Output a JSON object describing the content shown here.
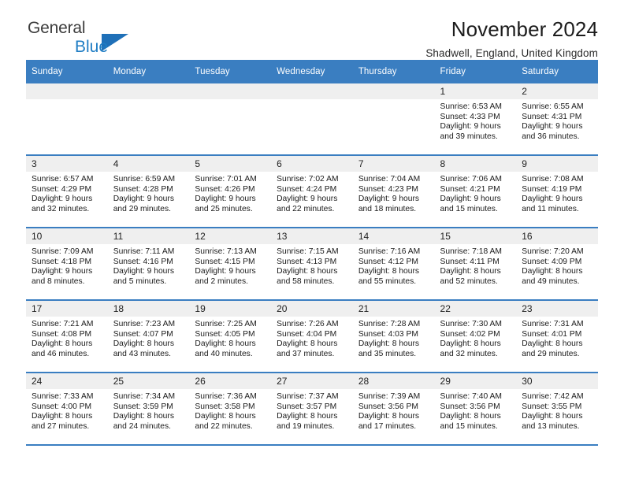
{
  "brand": {
    "name_part1": "General",
    "name_part2": "Blue",
    "triangle_color": "#1f70b8",
    "blue_color": "#1f7dc4"
  },
  "header": {
    "title": "November 2024",
    "subtitle": "Shadwell, England, United Kingdom"
  },
  "theme": {
    "header_band": "#3a7ec1",
    "daynum_band": "#efefef",
    "text": "#1b1b1b"
  },
  "weekday_headers": [
    "Sunday",
    "Monday",
    "Tuesday",
    "Wednesday",
    "Thursday",
    "Friday",
    "Saturday"
  ],
  "labels": {
    "sunrise_prefix": "Sunrise:",
    "sunset_prefix": "Sunset:",
    "daylight_prefix": "Daylight:"
  },
  "weeks": [
    [
      {
        "day": "",
        "empty": true
      },
      {
        "day": "",
        "empty": true
      },
      {
        "day": "",
        "empty": true
      },
      {
        "day": "",
        "empty": true
      },
      {
        "day": "",
        "empty": true
      },
      {
        "day": "1",
        "sunrise": "Sunrise: 6:53 AM",
        "sunset": "Sunset: 4:33 PM",
        "daylight_line1": "Daylight: 9 hours",
        "daylight_line2": "and 39 minutes."
      },
      {
        "day": "2",
        "sunrise": "Sunrise: 6:55 AM",
        "sunset": "Sunset: 4:31 PM",
        "daylight_line1": "Daylight: 9 hours",
        "daylight_line2": "and 36 minutes."
      }
    ],
    [
      {
        "day": "3",
        "sunrise": "Sunrise: 6:57 AM",
        "sunset": "Sunset: 4:29 PM",
        "daylight_line1": "Daylight: 9 hours",
        "daylight_line2": "and 32 minutes."
      },
      {
        "day": "4",
        "sunrise": "Sunrise: 6:59 AM",
        "sunset": "Sunset: 4:28 PM",
        "daylight_line1": "Daylight: 9 hours",
        "daylight_line2": "and 29 minutes."
      },
      {
        "day": "5",
        "sunrise": "Sunrise: 7:01 AM",
        "sunset": "Sunset: 4:26 PM",
        "daylight_line1": "Daylight: 9 hours",
        "daylight_line2": "and 25 minutes."
      },
      {
        "day": "6",
        "sunrise": "Sunrise: 7:02 AM",
        "sunset": "Sunset: 4:24 PM",
        "daylight_line1": "Daylight: 9 hours",
        "daylight_line2": "and 22 minutes."
      },
      {
        "day": "7",
        "sunrise": "Sunrise: 7:04 AM",
        "sunset": "Sunset: 4:23 PM",
        "daylight_line1": "Daylight: 9 hours",
        "daylight_line2": "and 18 minutes."
      },
      {
        "day": "8",
        "sunrise": "Sunrise: 7:06 AM",
        "sunset": "Sunset: 4:21 PM",
        "daylight_line1": "Daylight: 9 hours",
        "daylight_line2": "and 15 minutes."
      },
      {
        "day": "9",
        "sunrise": "Sunrise: 7:08 AM",
        "sunset": "Sunset: 4:19 PM",
        "daylight_line1": "Daylight: 9 hours",
        "daylight_line2": "and 11 minutes."
      }
    ],
    [
      {
        "day": "10",
        "sunrise": "Sunrise: 7:09 AM",
        "sunset": "Sunset: 4:18 PM",
        "daylight_line1": "Daylight: 9 hours",
        "daylight_line2": "and 8 minutes."
      },
      {
        "day": "11",
        "sunrise": "Sunrise: 7:11 AM",
        "sunset": "Sunset: 4:16 PM",
        "daylight_line1": "Daylight: 9 hours",
        "daylight_line2": "and 5 minutes."
      },
      {
        "day": "12",
        "sunrise": "Sunrise: 7:13 AM",
        "sunset": "Sunset: 4:15 PM",
        "daylight_line1": "Daylight: 9 hours",
        "daylight_line2": "and 2 minutes."
      },
      {
        "day": "13",
        "sunrise": "Sunrise: 7:15 AM",
        "sunset": "Sunset: 4:13 PM",
        "daylight_line1": "Daylight: 8 hours",
        "daylight_line2": "and 58 minutes."
      },
      {
        "day": "14",
        "sunrise": "Sunrise: 7:16 AM",
        "sunset": "Sunset: 4:12 PM",
        "daylight_line1": "Daylight: 8 hours",
        "daylight_line2": "and 55 minutes."
      },
      {
        "day": "15",
        "sunrise": "Sunrise: 7:18 AM",
        "sunset": "Sunset: 4:11 PM",
        "daylight_line1": "Daylight: 8 hours",
        "daylight_line2": "and 52 minutes."
      },
      {
        "day": "16",
        "sunrise": "Sunrise: 7:20 AM",
        "sunset": "Sunset: 4:09 PM",
        "daylight_line1": "Daylight: 8 hours",
        "daylight_line2": "and 49 minutes."
      }
    ],
    [
      {
        "day": "17",
        "sunrise": "Sunrise: 7:21 AM",
        "sunset": "Sunset: 4:08 PM",
        "daylight_line1": "Daylight: 8 hours",
        "daylight_line2": "and 46 minutes."
      },
      {
        "day": "18",
        "sunrise": "Sunrise: 7:23 AM",
        "sunset": "Sunset: 4:07 PM",
        "daylight_line1": "Daylight: 8 hours",
        "daylight_line2": "and 43 minutes."
      },
      {
        "day": "19",
        "sunrise": "Sunrise: 7:25 AM",
        "sunset": "Sunset: 4:05 PM",
        "daylight_line1": "Daylight: 8 hours",
        "daylight_line2": "and 40 minutes."
      },
      {
        "day": "20",
        "sunrise": "Sunrise: 7:26 AM",
        "sunset": "Sunset: 4:04 PM",
        "daylight_line1": "Daylight: 8 hours",
        "daylight_line2": "and 37 minutes."
      },
      {
        "day": "21",
        "sunrise": "Sunrise: 7:28 AM",
        "sunset": "Sunset: 4:03 PM",
        "daylight_line1": "Daylight: 8 hours",
        "daylight_line2": "and 35 minutes."
      },
      {
        "day": "22",
        "sunrise": "Sunrise: 7:30 AM",
        "sunset": "Sunset: 4:02 PM",
        "daylight_line1": "Daylight: 8 hours",
        "daylight_line2": "and 32 minutes."
      },
      {
        "day": "23",
        "sunrise": "Sunrise: 7:31 AM",
        "sunset": "Sunset: 4:01 PM",
        "daylight_line1": "Daylight: 8 hours",
        "daylight_line2": "and 29 minutes."
      }
    ],
    [
      {
        "day": "24",
        "sunrise": "Sunrise: 7:33 AM",
        "sunset": "Sunset: 4:00 PM",
        "daylight_line1": "Daylight: 8 hours",
        "daylight_line2": "and 27 minutes."
      },
      {
        "day": "25",
        "sunrise": "Sunrise: 7:34 AM",
        "sunset": "Sunset: 3:59 PM",
        "daylight_line1": "Daylight: 8 hours",
        "daylight_line2": "and 24 minutes."
      },
      {
        "day": "26",
        "sunrise": "Sunrise: 7:36 AM",
        "sunset": "Sunset: 3:58 PM",
        "daylight_line1": "Daylight: 8 hours",
        "daylight_line2": "and 22 minutes."
      },
      {
        "day": "27",
        "sunrise": "Sunrise: 7:37 AM",
        "sunset": "Sunset: 3:57 PM",
        "daylight_line1": "Daylight: 8 hours",
        "daylight_line2": "and 19 minutes."
      },
      {
        "day": "28",
        "sunrise": "Sunrise: 7:39 AM",
        "sunset": "Sunset: 3:56 PM",
        "daylight_line1": "Daylight: 8 hours",
        "daylight_line2": "and 17 minutes."
      },
      {
        "day": "29",
        "sunrise": "Sunrise: 7:40 AM",
        "sunset": "Sunset: 3:56 PM",
        "daylight_line1": "Daylight: 8 hours",
        "daylight_line2": "and 15 minutes."
      },
      {
        "day": "30",
        "sunrise": "Sunrise: 7:42 AM",
        "sunset": "Sunset: 3:55 PM",
        "daylight_line1": "Daylight: 8 hours",
        "daylight_line2": "and 13 minutes."
      }
    ]
  ]
}
